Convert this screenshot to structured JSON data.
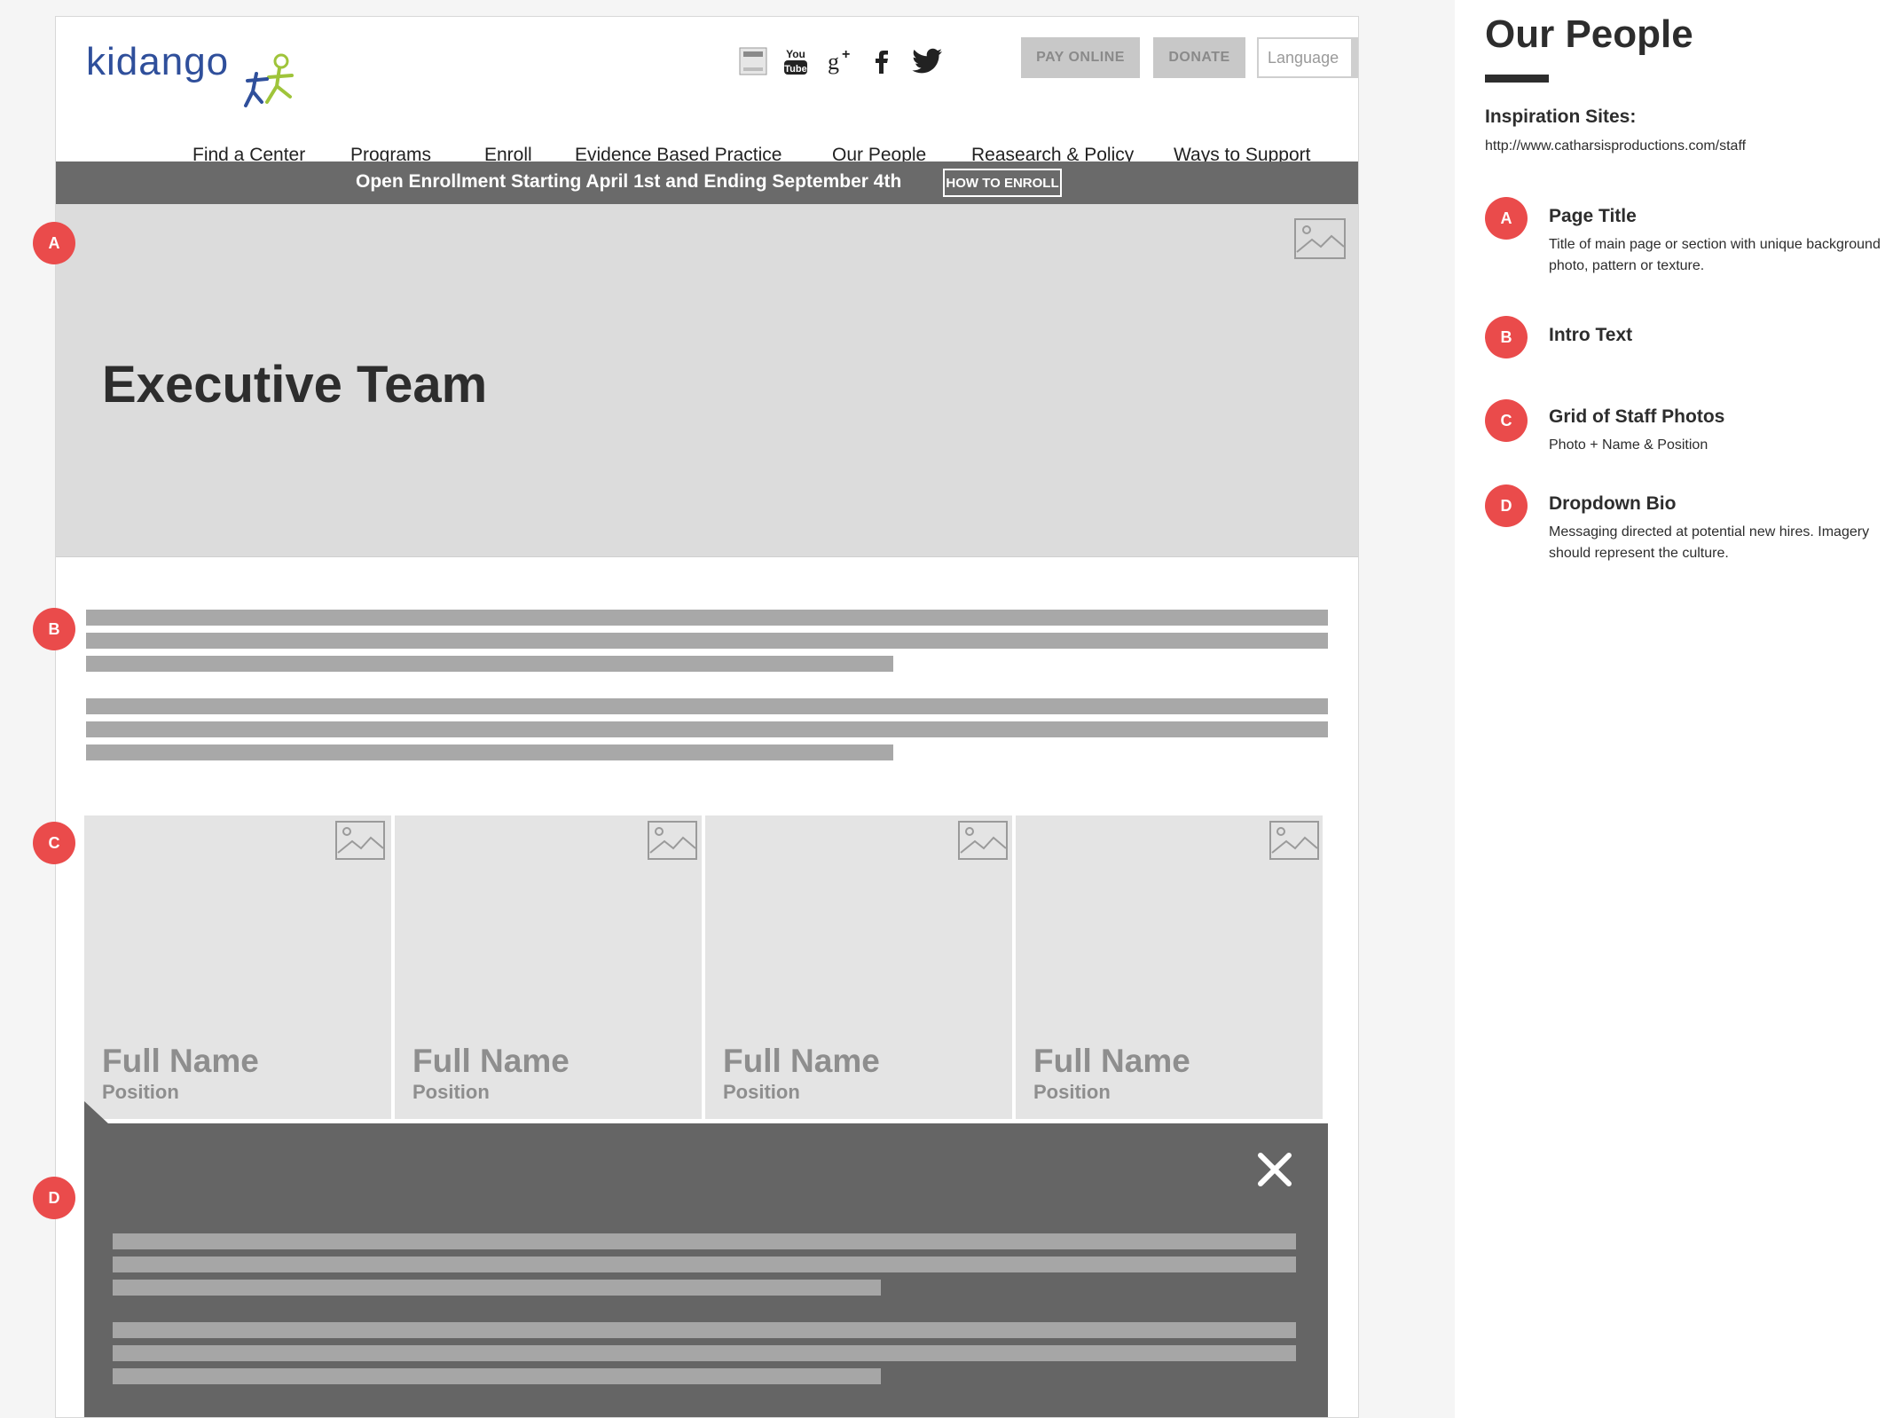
{
  "header": {
    "logo_text": "kidango",
    "social_icons": [
      "smile-icon",
      "youtube-icon",
      "google-plus-icon",
      "facebook-icon",
      "twitter-icon"
    ],
    "pay_online_label": "PAY ONLINE",
    "donate_label": "DONATE",
    "language_label": "Language",
    "nav": [
      "Find a Center",
      "Programs",
      "Enroll",
      "Evidence Based Practice",
      "Our People",
      "Reasearch & Policy",
      "Ways to Support"
    ]
  },
  "banner": {
    "text": "Open Enrollment Starting  April 1st and Ending September 4th",
    "button_label": "HOW TO ENROLL"
  },
  "hero": {
    "title": "Executive Team"
  },
  "staff": [
    {
      "name": "Full Name",
      "position": "Position"
    },
    {
      "name": "Full Name",
      "position": "Position"
    },
    {
      "name": "Full Name",
      "position": "Position"
    },
    {
      "name": "Full Name",
      "position": "Position"
    }
  ],
  "markers": [
    "A",
    "B",
    "C",
    "D"
  ],
  "panel": {
    "title": "Our People",
    "inspiration_label": "Inspiration Sites:",
    "inspiration_url": "http://www.catharsisproductions.com/staff",
    "items": [
      {
        "marker": "A",
        "title": "Page Title",
        "desc": "Title of main page or section with unique background photo, pattern or texture."
      },
      {
        "marker": "B",
        "title": "Intro Text",
        "desc": ""
      },
      {
        "marker": "C",
        "title": "Grid of Staff Photos",
        "desc": "Photo + Name & Position"
      },
      {
        "marker": "D",
        "title": "Dropdown Bio",
        "desc": "Messaging directed at potential new hires. Imagery should represent the culture."
      }
    ]
  },
  "colors": {
    "marker": "#ea4b4b",
    "banner": "#6a6a6a",
    "bio_panel": "#656565",
    "hero_bg": "#dcdcdc",
    "logo_blue": "#2f4f9b",
    "logo_green": "#9fc43a"
  }
}
